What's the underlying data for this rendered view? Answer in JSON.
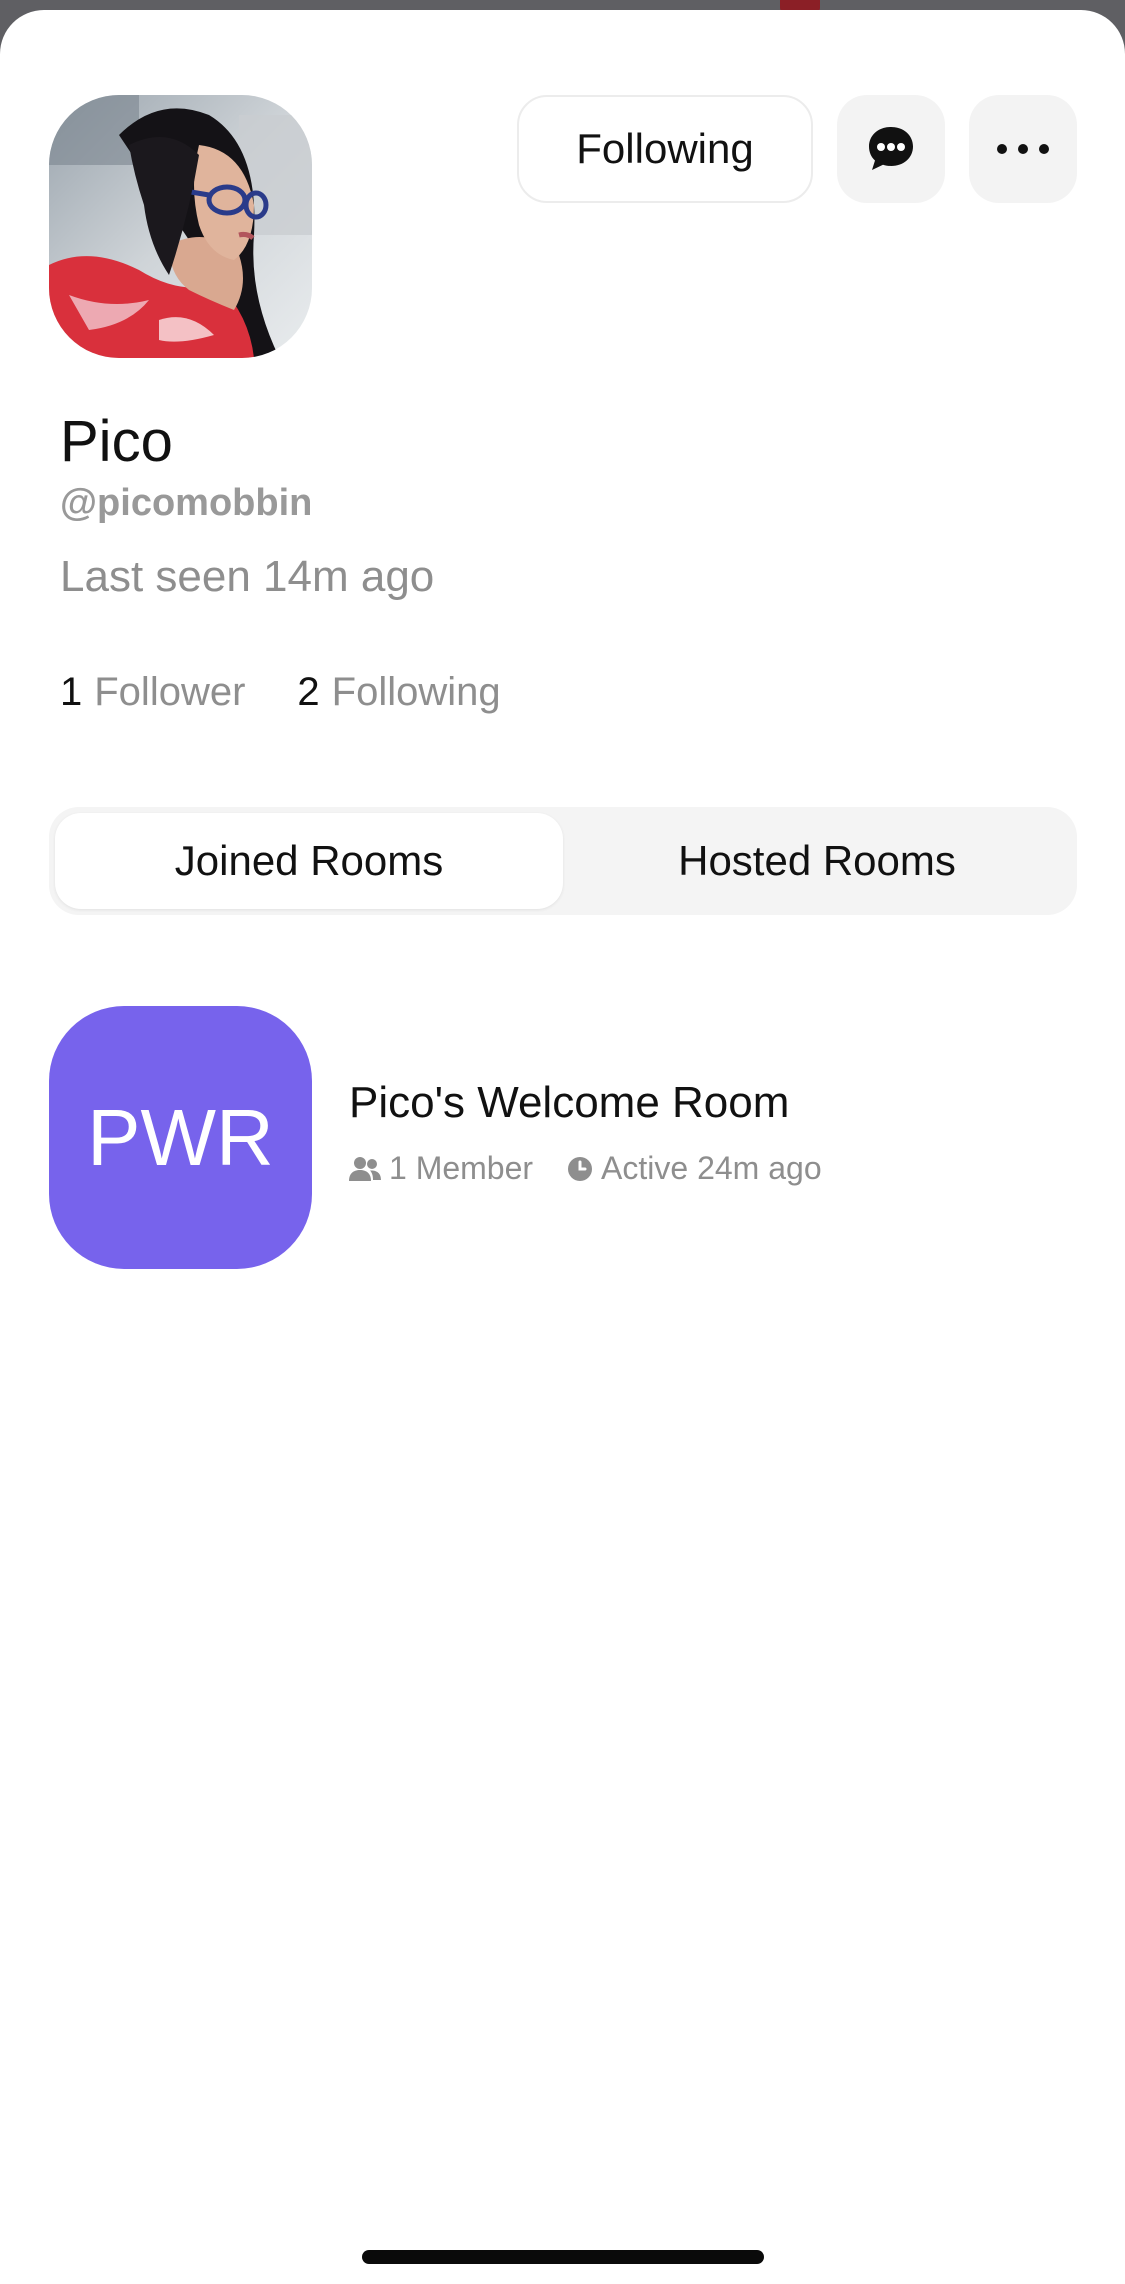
{
  "profile": {
    "name": "Pico",
    "handle": "@picomobbin",
    "last_seen": "Last seen 14m ago",
    "avatar_icon": "profile-photo"
  },
  "actions": {
    "following_label": "Following",
    "chat_icon": "chat-bubble-icon",
    "more_icon": "more-horizontal-icon"
  },
  "stats": {
    "followers_count": "1",
    "followers_label": "Follower",
    "following_count": "2",
    "following_label": "Following"
  },
  "tabs": [
    {
      "label": "Joined Rooms",
      "active": true
    },
    {
      "label": "Hosted Rooms",
      "active": false
    }
  ],
  "rooms": [
    {
      "initials": "PWR",
      "title": "Pico's Welcome Room",
      "members": "1 Member",
      "activity": "Active 24m ago",
      "color": "#7763ec"
    }
  ],
  "colors": {
    "accent": "#7763ec",
    "muted_text": "#8e8e8e",
    "button_bg": "#f3f3f3"
  }
}
